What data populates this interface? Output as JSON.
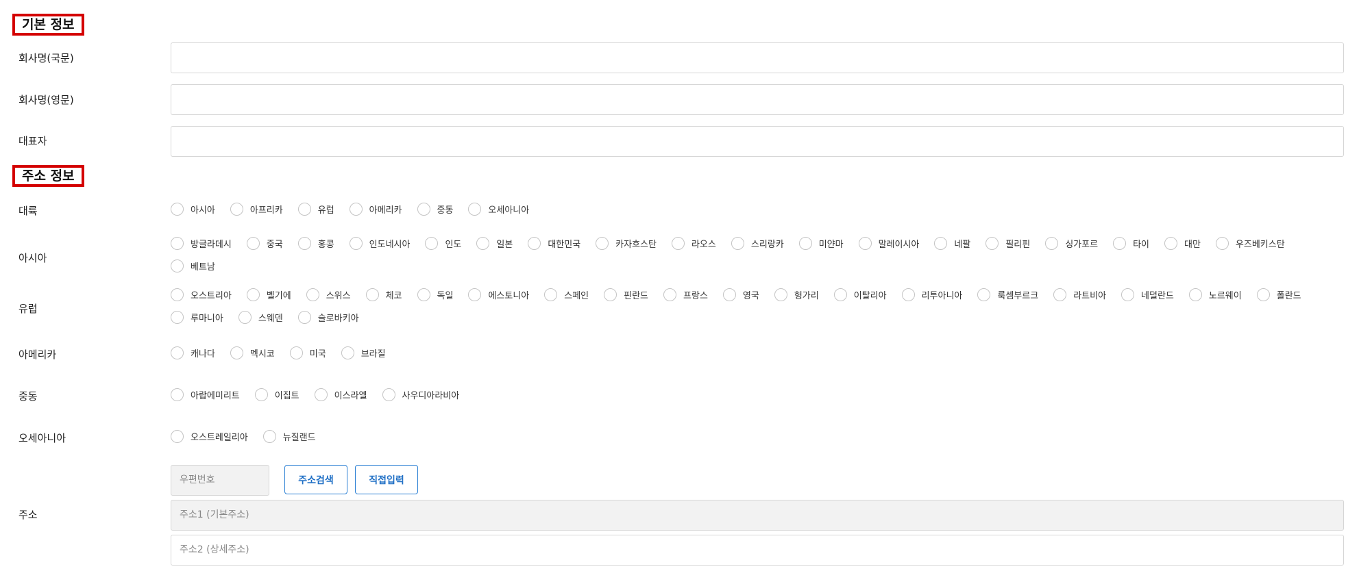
{
  "basic_info": {
    "title": "기본 정보",
    "company_kr_label": "회사명(국문)",
    "company_kr_value": "",
    "company_en_label": "회사명(영문)",
    "company_en_value": "",
    "ceo_label": "대표자",
    "ceo_value": ""
  },
  "address_info": {
    "title": "주소 정보",
    "continent": {
      "label": "대륙",
      "options": [
        "아시아",
        "아프리카",
        "유럽",
        "아메리카",
        "중동",
        "오세아니아"
      ]
    },
    "asia": {
      "label": "아시아",
      "options": [
        "방글라데시",
        "중국",
        "홍콩",
        "인도네시아",
        "인도",
        "일본",
        "대한민국",
        "카자흐스탄",
        "라오스",
        "스리랑카",
        "미얀마",
        "말레이시아",
        "네팔",
        "필리핀",
        "싱가포르",
        "타이",
        "대만",
        "우즈베키스탄",
        "베트남"
      ]
    },
    "europe": {
      "label": "유럽",
      "options": [
        "오스트리아",
        "벨기에",
        "스위스",
        "체코",
        "독일",
        "에스토니아",
        "스페인",
        "핀란드",
        "프랑스",
        "영국",
        "헝가리",
        "이탈리아",
        "리투아니아",
        "룩셈부르크",
        "라트비아",
        "네덜란드",
        "노르웨이",
        "폴란드",
        "루마니아",
        "스웨덴",
        "슬로바키아"
      ]
    },
    "america": {
      "label": "아메리카",
      "options": [
        "캐나다",
        "멕시코",
        "미국",
        "브라질"
      ]
    },
    "middle_east": {
      "label": "중동",
      "options": [
        "아랍에미리트",
        "이집트",
        "이스라엘",
        "사우디아라비아"
      ]
    },
    "oceania": {
      "label": "오세아니아",
      "options": [
        "오스트레일리아",
        "뉴질랜드"
      ]
    },
    "address": {
      "label": "주소",
      "zip_placeholder": "우편번호",
      "search_button": "주소검색",
      "manual_button": "직접입력",
      "addr1_placeholder": "주소1 (기본주소)",
      "addr2_placeholder": "주소2 (상세주소)"
    }
  },
  "colors": {
    "section_border": "#d40000",
    "button_blue": "#2a7fd4",
    "readonly_bg": "#f2f2f2"
  }
}
